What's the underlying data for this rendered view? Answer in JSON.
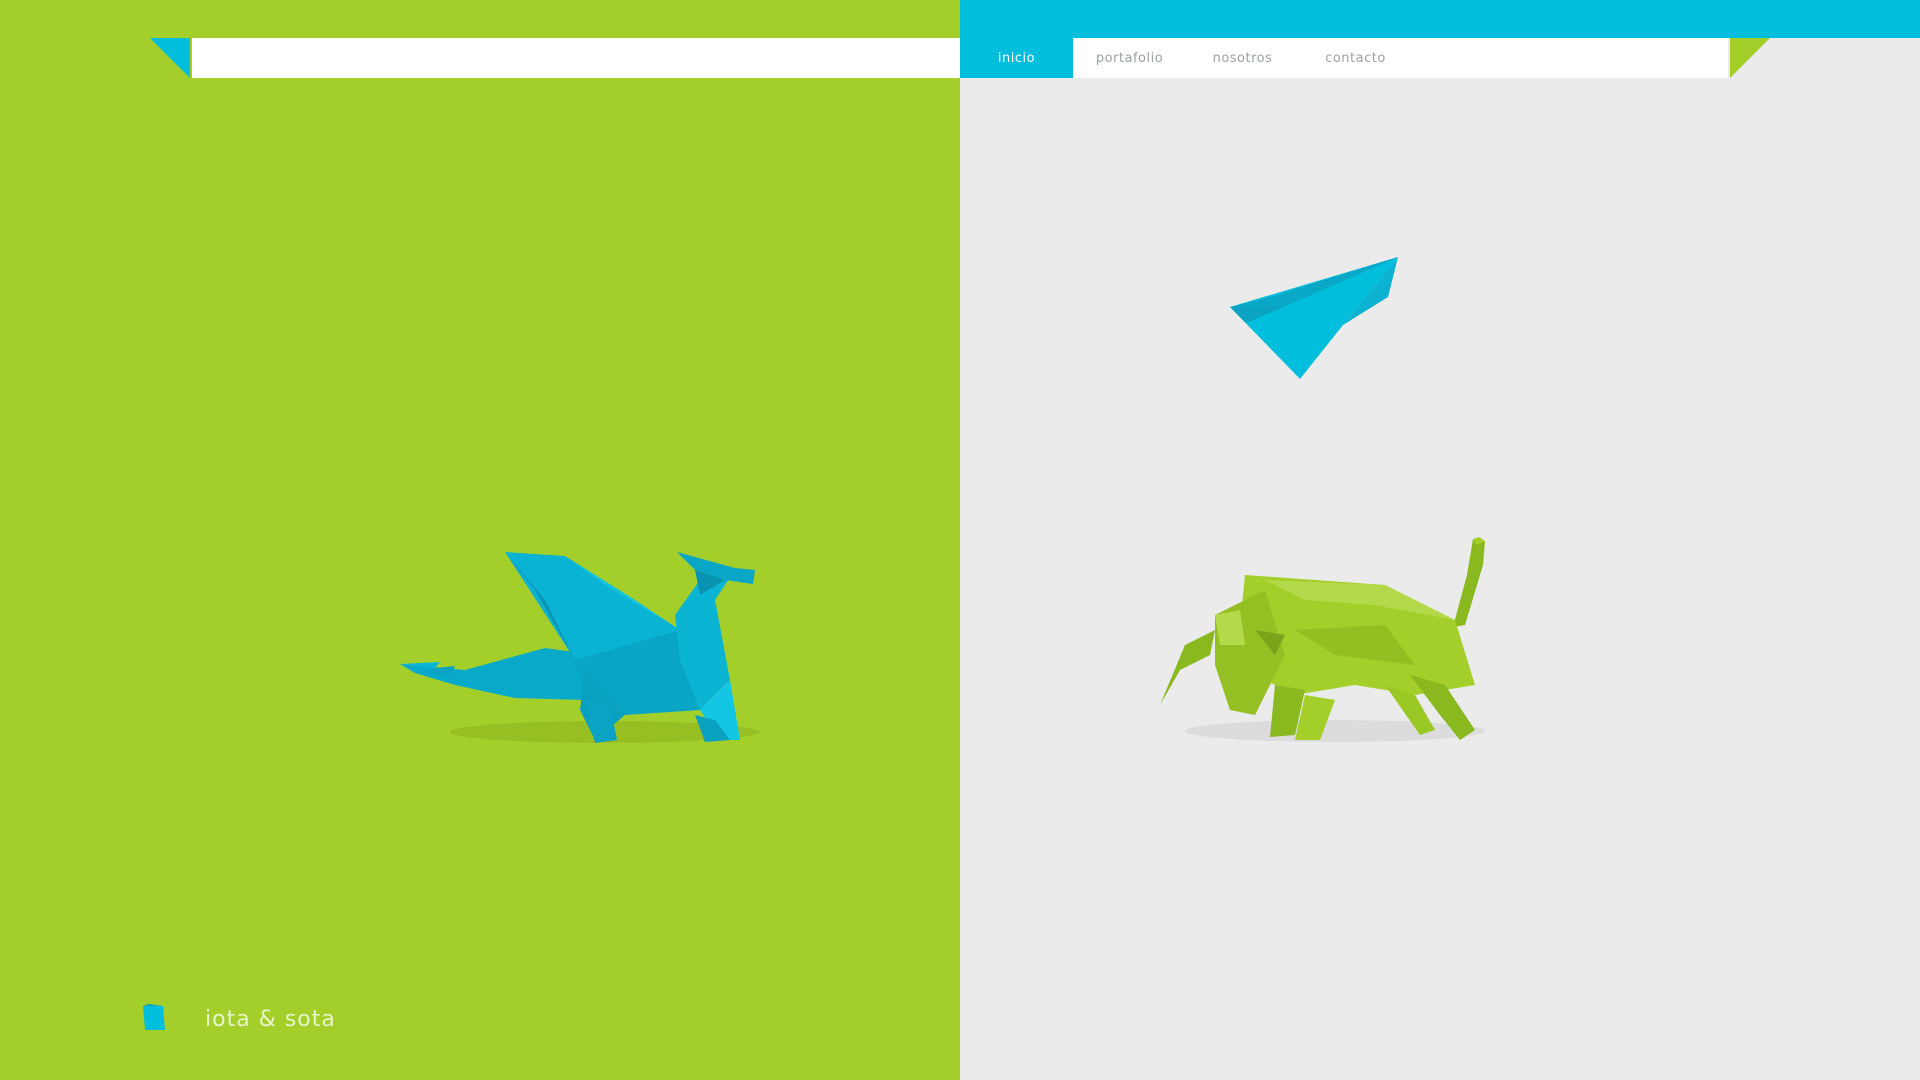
{
  "colors": {
    "green": "#a4cf2b",
    "cyan": "#00bedc",
    "light_gray": "#ebebeb",
    "white": "#ffffff"
  },
  "nav": {
    "items": [
      {
        "label": "inicio",
        "active": true
      },
      {
        "label": "portafolio",
        "active": false
      },
      {
        "label": "nosotros",
        "active": false
      },
      {
        "label": "contacto",
        "active": false
      }
    ]
  },
  "illustrations": {
    "left": "origami-dragon-icon",
    "right_top": "paper-plane-icon",
    "right_bottom": "origami-bull-icon"
  },
  "brand": {
    "name": "iota & sota",
    "logo_icon": "folded-square-logo-icon"
  }
}
